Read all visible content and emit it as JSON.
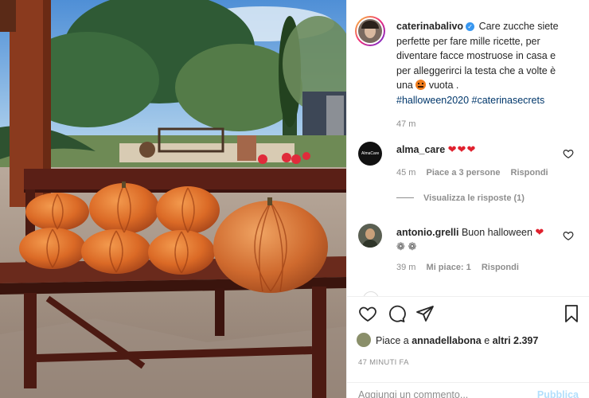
{
  "post": {
    "author": "caterinabalivo",
    "caption_lines": [
      "Care zucche siete",
      "perfette per fare mille ricette, per",
      "diventare facce mostruose in casa e",
      "per alleggerirci la testa che a volte è",
      "una",
      "vuota ."
    ],
    "hashtags": "#halloween2020 #caterinasecrets",
    "caption_time": "47 m"
  },
  "comments": [
    {
      "user": "alma_care",
      "text": "❤❤❤",
      "time": "45 m",
      "likes": "Piace a 3 persone",
      "reply": "Rispondi",
      "view_replies": "Visualizza le risposte (1)"
    },
    {
      "user": "antonio.grelli",
      "text_line1": "Buon halloween",
      "text_hearts": "❤",
      "text_line2": "❁ ❁",
      "time": "39 m",
      "likes": "Mi piace: 1",
      "reply": "Rispondi"
    }
  ],
  "footer": {
    "likes_prefix": "Piace a",
    "likes_user": "annadellabona",
    "likes_mid": "e",
    "likes_others": "altri 2.397",
    "time_ago": "47 MINUTI FA",
    "comment_placeholder": "Aggiungi un commento...",
    "publish_label": "Pubblica"
  },
  "icons": {
    "like": "heart-outline-icon",
    "comment": "comment-bubble-icon",
    "share": "paper-plane-icon",
    "save": "bookmark-icon"
  },
  "colors": {
    "link": "#00376b",
    "muted": "#8e8e8e",
    "heart_red": "#e0212e",
    "verified": "#3897f0",
    "publish_disabled": "#b2dffc"
  }
}
